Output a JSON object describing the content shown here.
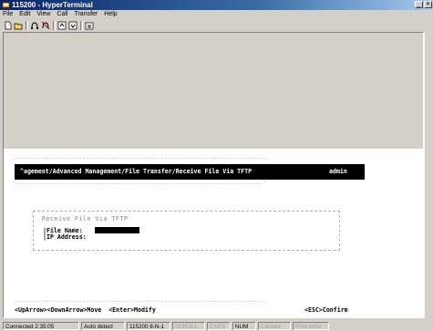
{
  "window": {
    "title": "115200 - HyperTerminal"
  },
  "menu": [
    "File",
    "Edit",
    "View",
    "Call",
    "Transfer",
    "Help"
  ],
  "toolbar": [
    "new-connection",
    "open",
    "connect",
    "disconnect",
    "send",
    "receive",
    "properties"
  ],
  "terminal": {
    "path": "^agement/Advanced Management/File Transfer/Receive File Via TFTP",
    "user": "admin",
    "box_title": "Receive File Via TFTP",
    "fields": [
      {
        "label": "File Name:",
        "value": ""
      },
      {
        "label": "IP Address:",
        "value": ""
      }
    ],
    "help_left": "<UpArrow><DownArrow>Move  <Enter>Modify",
    "help_right": "<ESC>Confirm"
  },
  "statusbar": {
    "connected": "Connected 2:35:05",
    "detect": "Auto detect",
    "settings": "115200 8-N-1",
    "scroll": "SCROLL",
    "caps": "CAPS",
    "num": "NUM",
    "capture": "Capture",
    "print_echo": "Print echo"
  },
  "colors": {
    "titlebar": "#0a246a",
    "terminal_bg": "#ffffff",
    "chrome": "#d4d0c8"
  }
}
